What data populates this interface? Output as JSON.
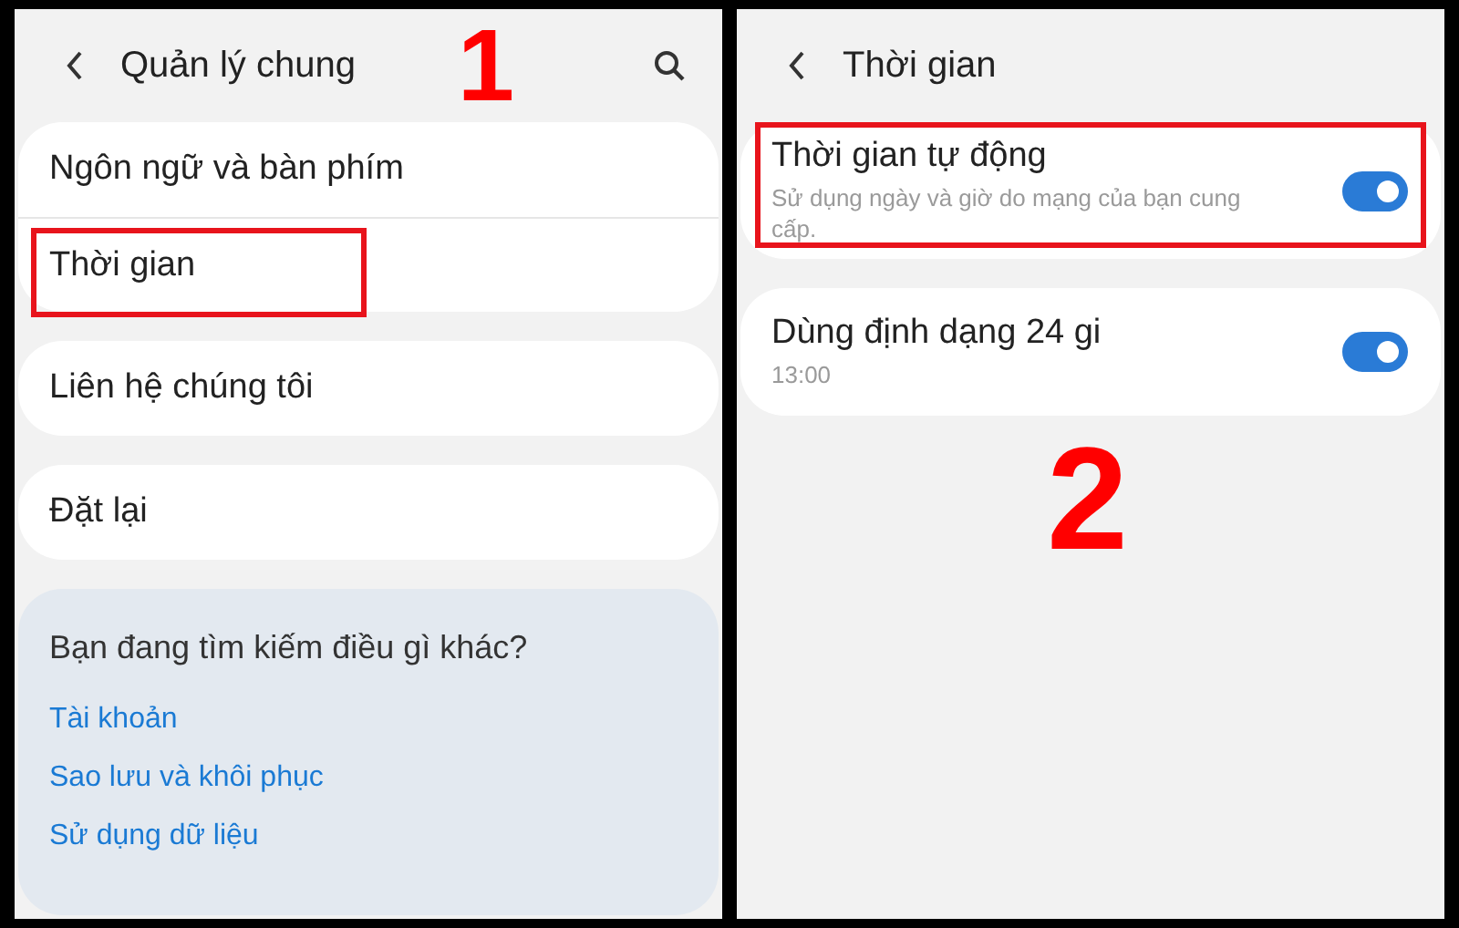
{
  "screens": [
    {
      "title": "Quản lý chung",
      "search": true,
      "step": "1",
      "groups": [
        {
          "items": [
            {
              "label": "Ngôn ngữ và bàn phím",
              "highlighted": false
            },
            {
              "label": "Thời gian",
              "highlighted": true
            }
          ]
        },
        {
          "items": [
            {
              "label": "Liên hệ chúng tôi",
              "highlighted": false
            }
          ]
        },
        {
          "items": [
            {
              "label": "Đặt lại",
              "highlighted": false
            }
          ]
        }
      ],
      "suggestions": {
        "heading": "Bạn đang tìm kiếm điều gì khác?",
        "links": [
          "Tài khoản",
          "Sao lưu và khôi phục",
          "Sử dụng dữ liệu"
        ]
      }
    },
    {
      "title": "Thời gian",
      "search": false,
      "step": "2",
      "groups": [
        {
          "items": [
            {
              "label": "Thời gian tự động",
              "subtitle": "Sử dụng ngày và giờ do mạng của bạn cung cấp.",
              "on": true,
              "highlighted": true
            }
          ]
        },
        {
          "items": [
            {
              "label": "Dùng định dạng 24 gi",
              "subtitle": "13:00",
              "on": true,
              "highlighted": false
            }
          ]
        }
      ]
    }
  ]
}
